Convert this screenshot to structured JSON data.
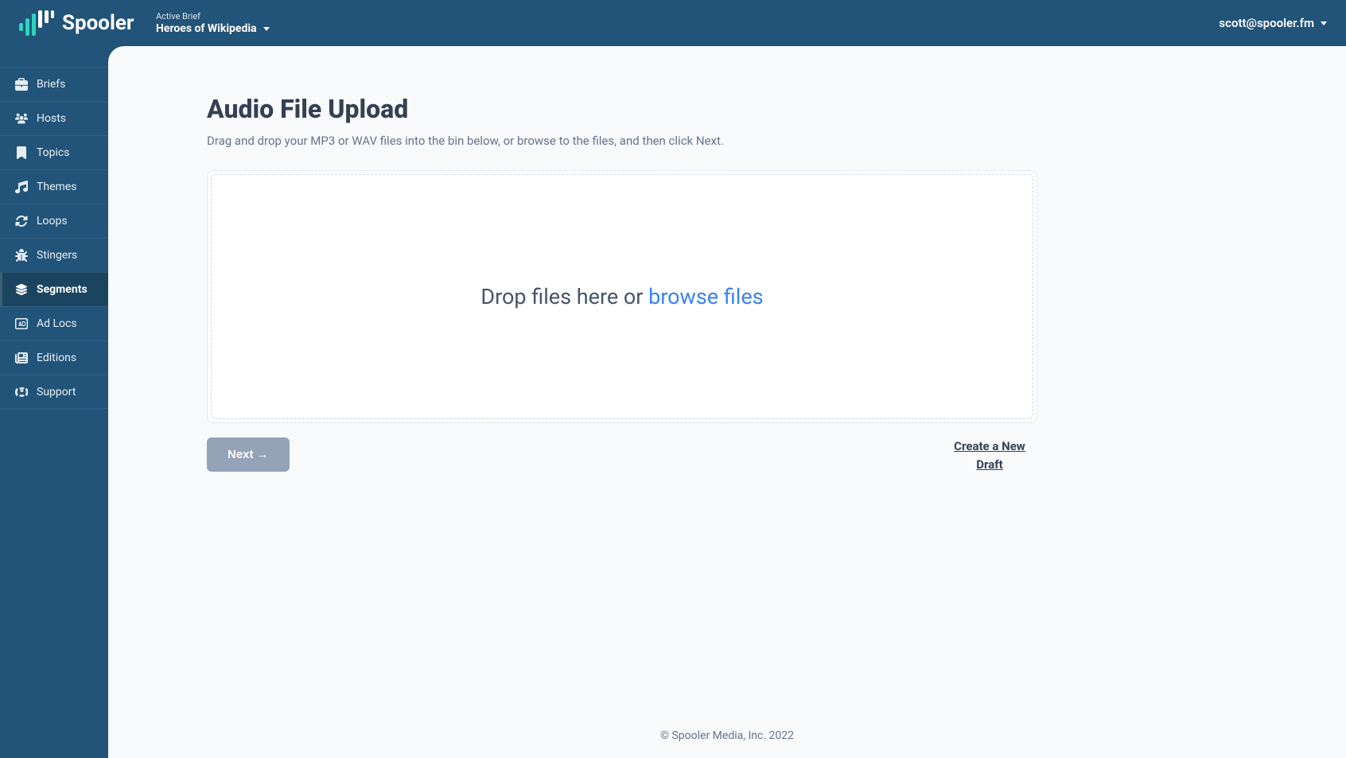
{
  "header": {
    "brand": "Spooler",
    "brief_label": "Active Brief",
    "brief_value": "Heroes of Wikipedia",
    "user_email": "scott@spooler.fm"
  },
  "sidebar": {
    "items": [
      {
        "label": "Briefs",
        "icon": "briefcase-icon"
      },
      {
        "label": "Hosts",
        "icon": "users-icon"
      },
      {
        "label": "Topics",
        "icon": "bookmark-icon"
      },
      {
        "label": "Themes",
        "icon": "music-icon"
      },
      {
        "label": "Loops",
        "icon": "sync-icon"
      },
      {
        "label": "Stingers",
        "icon": "bug-icon"
      },
      {
        "label": "Segments",
        "icon": "layers-icon"
      },
      {
        "label": "Ad Locs",
        "icon": "ad-icon"
      },
      {
        "label": "Editions",
        "icon": "newspaper-icon"
      },
      {
        "label": "Support",
        "icon": "lifering-icon"
      }
    ],
    "active_index": 6
  },
  "main": {
    "title": "Audio File Upload",
    "subtitle": "Drag and drop your MP3 or WAV files into the bin below, or browse to the files, and then click Next.",
    "drop_text_prefix": "Drop files here or ",
    "browse_text": "browse files",
    "next_button": "Next →",
    "create_link": "Create a New Draft"
  },
  "footer": {
    "copyright": "© Spooler Media, Inc. 2022"
  }
}
